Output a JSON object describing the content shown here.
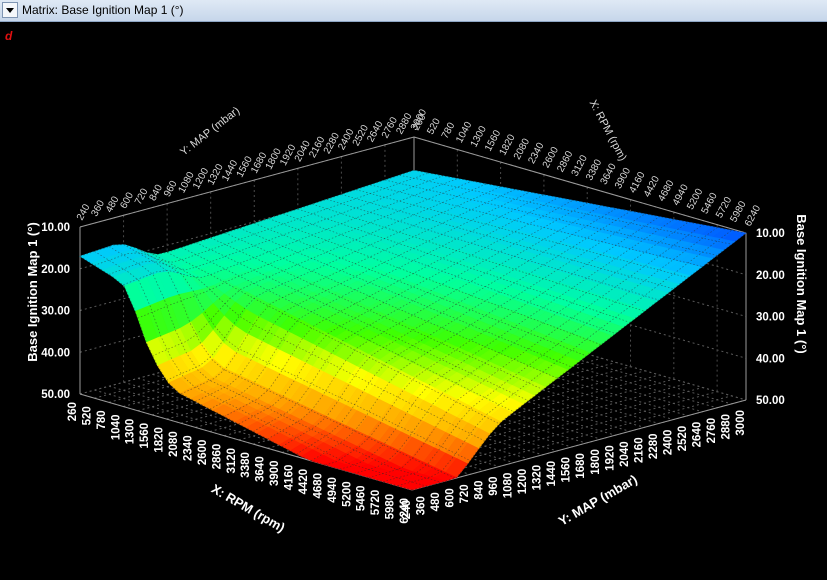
{
  "window": {
    "title": "Matrix: Base Ignition Map 1 (°)",
    "corner_mark": "d"
  },
  "chart_data": {
    "type": "surface",
    "zlabel": "Base Ignition Map 1 (°)",
    "xlabel": "X: RPM (rpm)",
    "ylabel": "Y: MAP (mbar)",
    "z_ticks": [
      "10.00",
      "20.00",
      "30.00",
      "40.00",
      "50.00"
    ],
    "zlim": [
      10,
      50
    ],
    "xlim": [
      260,
      6240
    ],
    "ylim": [
      240,
      3000
    ],
    "x_ticks": [
      "260",
      "520",
      "780",
      "1040",
      "1300",
      "1560",
      "1820",
      "2080",
      "2340",
      "2600",
      "2860",
      "3120",
      "3380",
      "3640",
      "3900",
      "4160",
      "4420",
      "4680",
      "4940",
      "5200",
      "5460",
      "5720",
      "5980",
      "6240"
    ],
    "y_ticks": [
      "240",
      "360",
      "480",
      "600",
      "720",
      "840",
      "960",
      "1080",
      "1200",
      "1320",
      "1440",
      "1560",
      "1680",
      "1800",
      "1920",
      "2040",
      "2160",
      "2280",
      "2400",
      "2520",
      "2640",
      "2760",
      "2880",
      "3000"
    ],
    "surface_summary": [
      {
        "rpm": 260,
        "map": 3000,
        "value": 18
      },
      {
        "rpm": 6240,
        "map": 3000,
        "value": 10
      },
      {
        "rpm": 260,
        "map": 240,
        "value": 23
      },
      {
        "rpm": 6240,
        "map": 240,
        "value": 50
      },
      {
        "rpm": 2340,
        "map": 1320,
        "value": 28
      }
    ],
    "colormap": [
      "#ff0000",
      "#ffa000",
      "#ffff00",
      "#40ff00",
      "#00ffa0",
      "#00c8ff",
      "#0050ff"
    ]
  }
}
